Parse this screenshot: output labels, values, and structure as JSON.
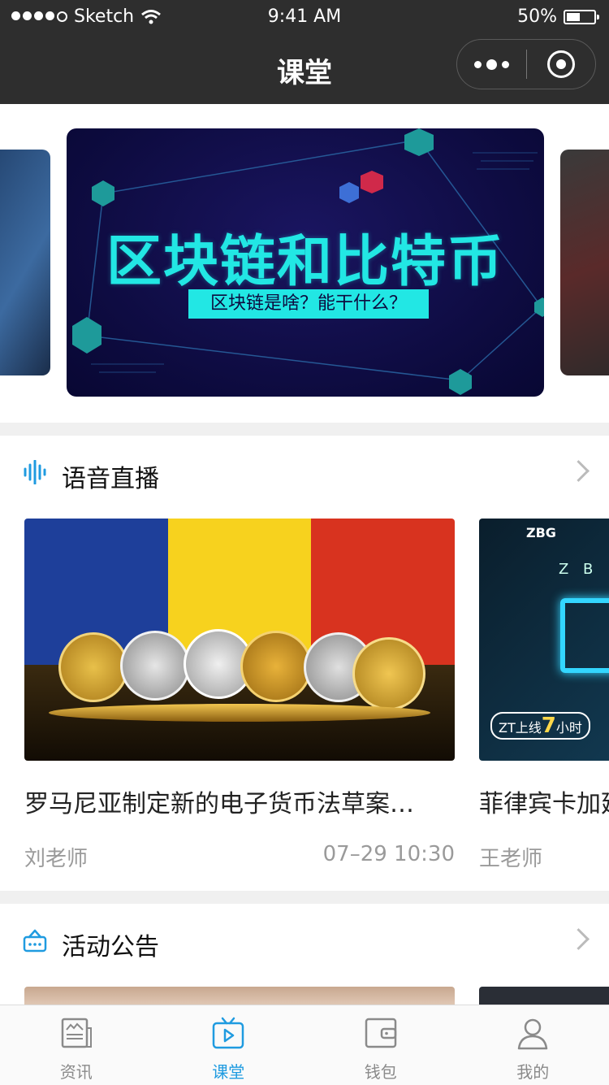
{
  "status_bar": {
    "carrier": "Sketch",
    "time": "9:41 AM",
    "battery": "50%",
    "battery_level": 0.5
  },
  "nav": {
    "title": "课堂"
  },
  "banner": {
    "title": "区块链和比特币",
    "subtitle": "区块链是啥？能干什么？"
  },
  "sections": {
    "live": {
      "title": "语音直播",
      "icon": "soundwave-icon",
      "cards": [
        {
          "title": "罗马尼亚制定新的电子货币法草案…",
          "author": "刘老师",
          "time": "07–29 10:30"
        },
        {
          "title": "菲律宾卡加延",
          "author": "王老师",
          "time": ""
        }
      ],
      "card2_texts": {
        "brand": "ZBG",
        "line": "Z B",
        "tag": "ZT上线",
        "num": "7",
        "unit": "小时"
      }
    },
    "notice": {
      "title": "活动公告",
      "icon": "notice-board-icon"
    }
  },
  "tabs": [
    {
      "label": "资讯",
      "icon": "news-icon",
      "active": false
    },
    {
      "label": "课堂",
      "icon": "video-play-icon",
      "active": true
    },
    {
      "label": "钱包",
      "icon": "wallet-icon",
      "active": false
    },
    {
      "label": "我的",
      "icon": "user-icon",
      "active": false
    }
  ],
  "colors": {
    "accent": "#1f9be0",
    "banner_cyan": "#22e7e4",
    "nav_bg": "#2e2e2e"
  }
}
